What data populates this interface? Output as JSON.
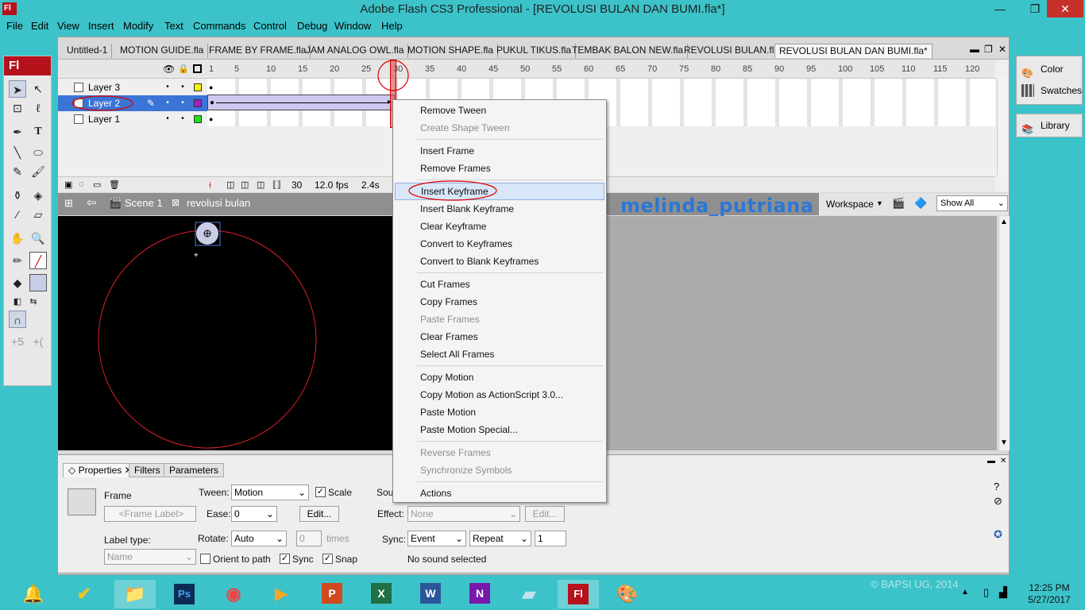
{
  "window": {
    "app_icon": "Fl",
    "title": "Adobe Flash CS3 Professional - [REVOLUSI BULAN DAN BUMI.fla*]",
    "minimize": "—",
    "restore": "❐",
    "close": "✕"
  },
  "menu": [
    "File",
    "Edit",
    "View",
    "Insert",
    "Modify",
    "Text",
    "Commands",
    "Control",
    "Debug",
    "Window",
    "Help"
  ],
  "tools": {
    "logo": "Fl"
  },
  "tabs": [
    "Untitled-1",
    "MOTION GUIDE.fla",
    "FRAME BY FRAME.fla",
    "JAM ANALOG OWL.fla",
    "MOTION SHAPE.fla",
    "PUKUL TIKUS.fla",
    "TEMBAK BALON NEW.fla",
    "REVOLUSI BULAN.fla",
    "REVOLUSI BULAN DAN BUMI.fla*"
  ],
  "timeline": {
    "frame_numbers": [
      "1",
      "5",
      "10",
      "15",
      "20",
      "25",
      "30",
      "35",
      "40",
      "45",
      "50",
      "55",
      "60",
      "65",
      "70",
      "75",
      "80",
      "85",
      "90",
      "95",
      "100",
      "105",
      "110",
      "115",
      "120"
    ],
    "layers": [
      {
        "name": "Layer 3",
        "color": "#f2f20a"
      },
      {
        "name": "Layer 2",
        "color": "#a020c8"
      },
      {
        "name": "Layer 1",
        "color": "#22dd22"
      }
    ],
    "status": {
      "frame": "30",
      "fps": "12.0 fps",
      "time": "2.4s"
    }
  },
  "editbar": {
    "scene": "Scene 1",
    "symbol": "revolusi bulan",
    "watermark": "melinda_putriana",
    "workspace": "Workspace",
    "zoom": "Show All"
  },
  "context_menu": {
    "groups": [
      [
        {
          "label": "Remove Tween",
          "enabled": true
        },
        {
          "label": "Create Shape Tween",
          "enabled": false
        }
      ],
      [
        {
          "label": "Insert Frame",
          "enabled": true
        },
        {
          "label": "Remove Frames",
          "enabled": true
        }
      ],
      [
        {
          "label": "Insert Keyframe",
          "enabled": true,
          "highlighted": true
        },
        {
          "label": "Insert Blank Keyframe",
          "enabled": true
        },
        {
          "label": "Clear Keyframe",
          "enabled": true
        },
        {
          "label": "Convert to Keyframes",
          "enabled": true
        },
        {
          "label": "Convert to Blank Keyframes",
          "enabled": true
        }
      ],
      [
        {
          "label": "Cut Frames",
          "enabled": true
        },
        {
          "label": "Copy Frames",
          "enabled": true
        },
        {
          "label": "Paste Frames",
          "enabled": false
        },
        {
          "label": "Clear Frames",
          "enabled": true
        },
        {
          "label": "Select All Frames",
          "enabled": true
        }
      ],
      [
        {
          "label": "Copy Motion",
          "enabled": true
        },
        {
          "label": "Copy Motion as ActionScript 3.0...",
          "enabled": true
        },
        {
          "label": "Paste Motion",
          "enabled": true
        },
        {
          "label": "Paste Motion Special...",
          "enabled": true
        }
      ],
      [
        {
          "label": "Reverse Frames",
          "enabled": false
        },
        {
          "label": "Synchronize Symbols",
          "enabled": false
        }
      ],
      [
        {
          "label": "Actions",
          "enabled": true
        }
      ]
    ]
  },
  "properties": {
    "tabs": [
      "Properties",
      "Filters",
      "Parameters"
    ],
    "frame_label_title": "Frame",
    "frame_label_placeholder": "<Frame Label>",
    "label_type_label": "Label type:",
    "label_type_value": "Name",
    "tween_label": "Tween:",
    "tween_value": "Motion",
    "scale_label": "Scale",
    "ease_label": "Ease:",
    "ease_value": "0",
    "edit_button": "Edit...",
    "rotate_label": "Rotate:",
    "rotate_value": "Auto",
    "times_value": "0",
    "times_label": "times",
    "orient_label": "Orient to path",
    "sync_check_label": "Sync",
    "snap_label": "Snap",
    "sound_label": "Sou",
    "effect_label": "Effect:",
    "effect_value": "None",
    "effect_edit": "Edit...",
    "sync_label": "Sync:",
    "sync_value": "Event",
    "repeat_value": "Repeat",
    "repeat_count": "1",
    "no_sound": "No sound selected"
  },
  "right_panels": {
    "color": "Color",
    "swatches": "Swatches",
    "library": "Library"
  },
  "taskbar": {
    "watermark": "© BAPSI UG, 2014",
    "time": "12:25 PM",
    "date": "5/27/2017",
    "apps": [
      "Ps",
      "Fl"
    ]
  },
  "stage": {
    "background": "#000000",
    "orbit_color": "#d9202a",
    "moon_color": "#c9cde6"
  }
}
